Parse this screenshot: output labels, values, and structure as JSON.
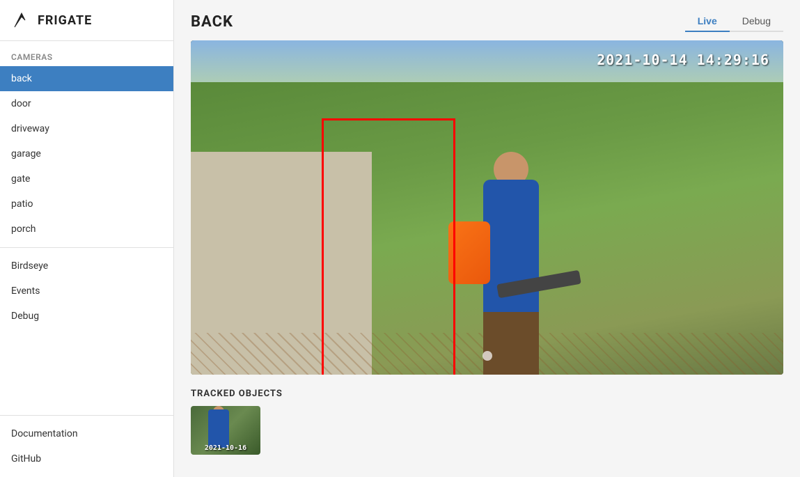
{
  "app": {
    "name": "FRIGATE"
  },
  "sidebar": {
    "cameras_label": "Cameras",
    "items": [
      {
        "id": "back",
        "label": "back",
        "active": true
      },
      {
        "id": "door",
        "label": "door",
        "active": false
      },
      {
        "id": "driveway",
        "label": "driveway",
        "active": false
      },
      {
        "id": "garage",
        "label": "garage",
        "active": false
      },
      {
        "id": "gate",
        "label": "gate",
        "active": false
      },
      {
        "id": "patio",
        "label": "patio",
        "active": false
      },
      {
        "id": "porch",
        "label": "porch",
        "active": false
      }
    ],
    "extra_items": [
      {
        "id": "birdseye",
        "label": "Birdseye"
      },
      {
        "id": "events",
        "label": "Events"
      },
      {
        "id": "debug",
        "label": "Debug"
      }
    ],
    "bottom_items": [
      {
        "id": "documentation",
        "label": "Documentation"
      },
      {
        "id": "github",
        "label": "GitHub"
      }
    ]
  },
  "main": {
    "page_title": "BACK",
    "tabs": [
      {
        "id": "live",
        "label": "Live",
        "active": true
      },
      {
        "id": "debug",
        "label": "Debug",
        "active": false
      }
    ],
    "timestamp": "2021-10-14 14:29:16",
    "tracked_objects_title": "TRACKED OBJECTS",
    "thumbnail_timestamp": "2021-10-16"
  }
}
